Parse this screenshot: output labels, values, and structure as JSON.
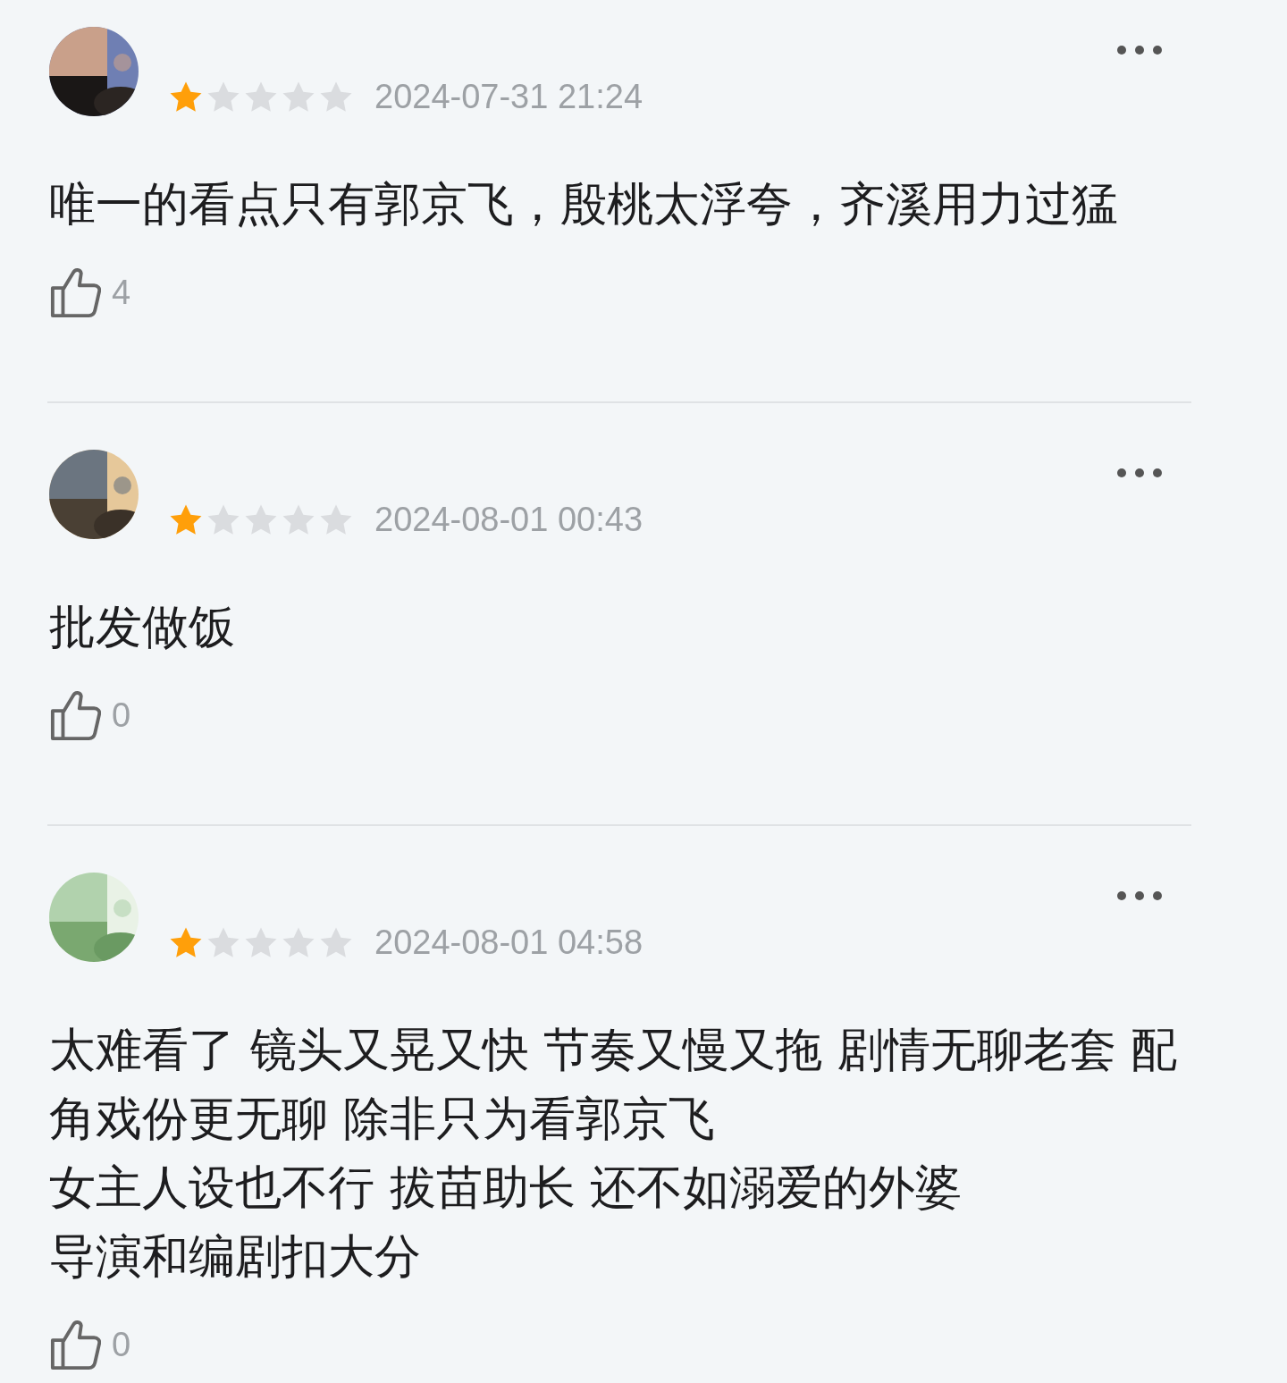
{
  "reviews": [
    {
      "stars": 1,
      "date": "2024-07-31 21:24",
      "text": [
        "唯一的看点只有郭京飞，殷桃太浮夸，齐溪用力过猛"
      ],
      "likes": "4"
    },
    {
      "stars": 1,
      "date": "2024-08-01 00:43",
      "text": [
        "批发做饭"
      ],
      "likes": "0"
    },
    {
      "stars": 1,
      "date": "2024-08-01 04:58",
      "text": [
        "太难看了 镜头又晃又快 节奏又慢又拖 剧情无聊老套 配角戏份更无聊 除非只为看郭京飞",
        "女主人设也不行 拔苗助长 还不如溺爱的外婆",
        "导演和编剧扣大分"
      ],
      "likes": "0"
    }
  ]
}
